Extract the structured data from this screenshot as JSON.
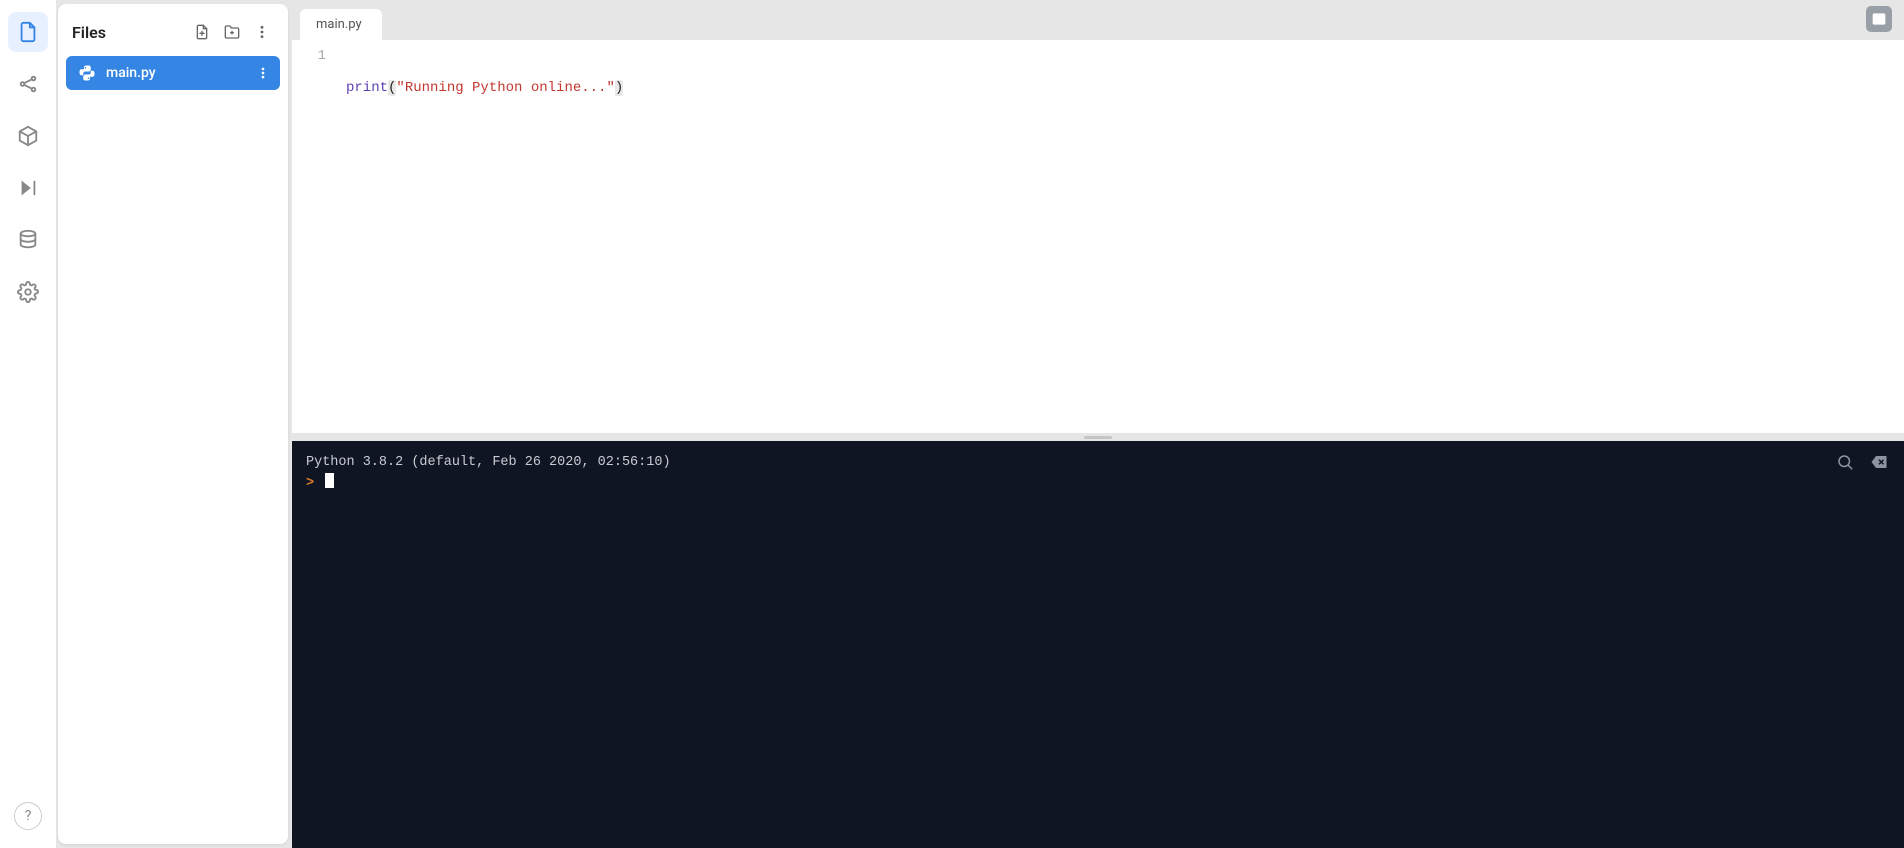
{
  "rail": {
    "items": [
      {
        "name": "files-icon",
        "active": true
      },
      {
        "name": "share-icon",
        "active": false
      },
      {
        "name": "packages-icon",
        "active": false
      },
      {
        "name": "run-icon",
        "active": false
      },
      {
        "name": "database-icon",
        "active": false
      },
      {
        "name": "settings-icon",
        "active": false
      }
    ],
    "help_label": "?"
  },
  "files": {
    "title": "Files",
    "items": [
      {
        "name": "main.py"
      }
    ]
  },
  "tabs": [
    {
      "label": "main.py"
    }
  ],
  "editor": {
    "lines": [
      {
        "number": "1",
        "tokens": {
          "func": "print",
          "open": "(",
          "str": "\"Running Python online...\"",
          "close": ")"
        }
      }
    ]
  },
  "console": {
    "banner": "Python 3.8.2 (default, Feb 26 2020, 02:56:10)",
    "prompt": ">"
  }
}
